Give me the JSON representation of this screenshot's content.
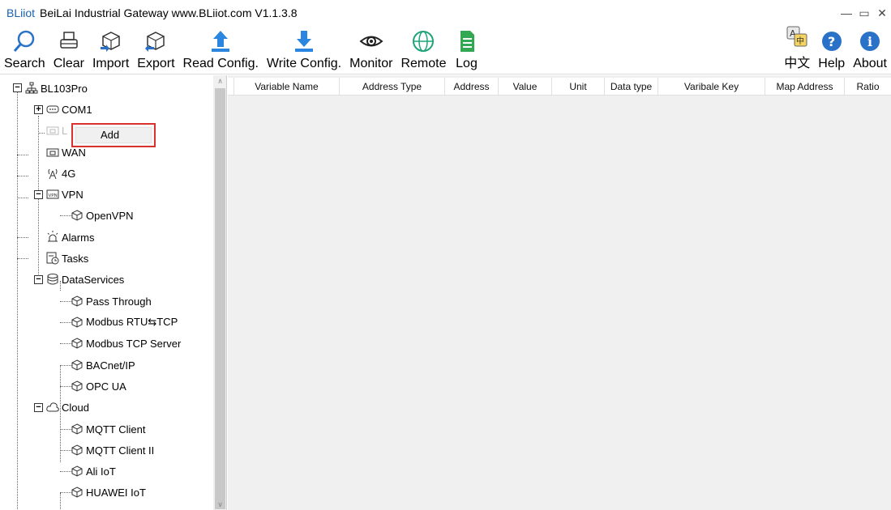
{
  "window": {
    "brand": "BLiiot",
    "title": "BeiLai Industrial Gateway www.BLiiot.com V1.1.3.8",
    "controls": {
      "minimize": "—",
      "maximize": "▭",
      "close": "✕"
    }
  },
  "toolbar": {
    "left": [
      {
        "id": "search",
        "label": "Search",
        "icon": "magnifier-icon"
      },
      {
        "id": "clear",
        "label": "Clear",
        "icon": "printer-icon"
      },
      {
        "id": "import",
        "label": "Import",
        "icon": "box-import-icon"
      },
      {
        "id": "export",
        "label": "Export",
        "icon": "box-export-icon"
      },
      {
        "id": "read",
        "label": "Read Config.",
        "icon": "upload-arrow-icon"
      },
      {
        "id": "write",
        "label": "Write Config.",
        "icon": "download-arrow-icon"
      },
      {
        "id": "monitor",
        "label": "Monitor",
        "icon": "eye-icon"
      },
      {
        "id": "remote",
        "label": "Remote",
        "icon": "globe-icon"
      },
      {
        "id": "log",
        "label": "Log",
        "icon": "document-icon"
      }
    ],
    "right": [
      {
        "id": "lang",
        "label": "中文",
        "icon": "language-icon"
      },
      {
        "id": "help",
        "label": "Help",
        "icon": "help-icon"
      },
      {
        "id": "about",
        "label": "About",
        "icon": "info-icon"
      }
    ]
  },
  "tree": {
    "root": "BL103Pro",
    "com1": "COM1",
    "lan_partial": "L",
    "wan": "WAN",
    "g4": "4G",
    "vpn": "VPN",
    "openvpn": "OpenVPN",
    "alarms": "Alarms",
    "tasks": "Tasks",
    "dataservices": "DataServices",
    "ds_items": [
      "Pass Through",
      "Modbus RTU⇆TCP",
      "Modbus TCP Server",
      "BACnet/IP",
      "OPC UA"
    ],
    "cloud": "Cloud",
    "cloud_items": [
      "MQTT Client",
      "MQTT Client II",
      "Ali IoT",
      "HUAWEI IoT"
    ]
  },
  "context_menu": {
    "add": "Add"
  },
  "grid": {
    "columns": [
      "Variable Name",
      "Address Type",
      "Address",
      "Value",
      "Unit",
      "Data type",
      "Varibale Key",
      "Map Address",
      "Ratio"
    ]
  },
  "colors": {
    "accent": "#1a62b0",
    "highlight": "#d9322e"
  }
}
